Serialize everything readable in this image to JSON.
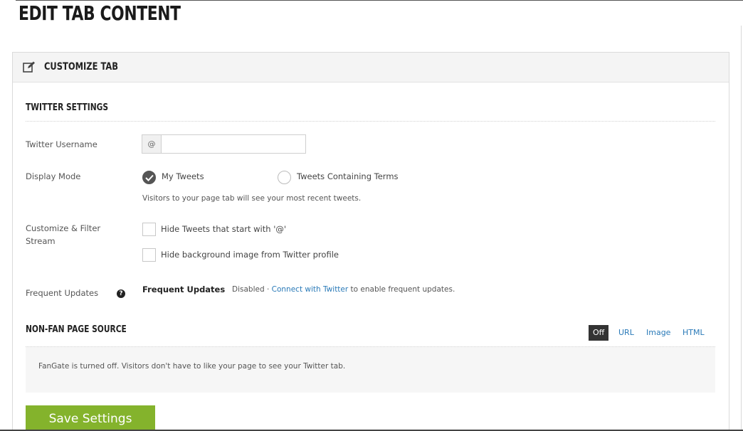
{
  "page": {
    "title": "Edit Tab Content"
  },
  "panel": {
    "title": "Customize Tab",
    "icon": "edit-icon"
  },
  "twitter_settings": {
    "section_title": "Twitter Settings",
    "username": {
      "label": "Twitter Username",
      "prefix": "@",
      "value": "",
      "placeholder": ""
    },
    "display_mode": {
      "label": "Display Mode",
      "options": [
        {
          "label": "My Tweets",
          "selected": true
        },
        {
          "label": "Tweets Containing Terms",
          "selected": false
        }
      ],
      "help": "Visitors to your page tab will see your most recent tweets."
    },
    "filter": {
      "label_line1": "Customize & Filter",
      "label_line2": "Stream",
      "options": [
        {
          "label": "Hide Tweets that start with '@'",
          "checked": false
        },
        {
          "label": "Hide background image from Twitter profile",
          "checked": false
        }
      ]
    },
    "frequent_updates": {
      "label": "Frequent Updates",
      "help_icon": "question-icon",
      "title": "Frequent Updates",
      "status": "Disabled · ",
      "link": "Connect with Twitter",
      "suffix": " to enable frequent updates."
    }
  },
  "non_fan": {
    "section_title": "Non-Fan Page Source",
    "tabs": [
      "Off",
      "URL",
      "Image",
      "HTML"
    ],
    "active_tab": "Off",
    "message": "FanGate is turned off. Visitors don't have to like your page to see your Twitter tab."
  },
  "actions": {
    "save_label": "Save Settings"
  },
  "colors": {
    "accent_green": "#84b32c",
    "link_blue": "#2a7ab8",
    "active_tab_bg": "#333333"
  }
}
